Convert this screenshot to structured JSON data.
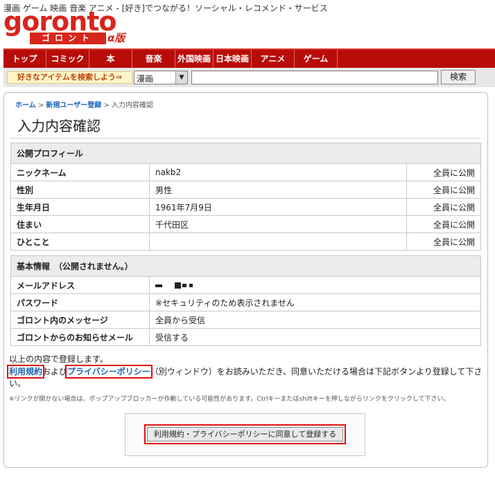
{
  "header": {
    "tagline": "漫画 ゲーム 映画 音楽 アニメ - [好き]でつながる！ソーシャル・レコメンド・サービス",
    "logo_text": "goronto",
    "logo_sub": "ゴロント",
    "logo_alpha": "α版"
  },
  "nav": {
    "items": [
      "トップ",
      "コミック",
      "本",
      "音楽",
      "外国映画",
      "日本映画",
      "アニメ",
      "ゲーム"
    ]
  },
  "search": {
    "label": "好きなアイテムを検索しよう⇒",
    "category": "漫画",
    "query": "",
    "button": "検索"
  },
  "breadcrumb": {
    "home": "ホーム",
    "register": "新規ユーザー登録",
    "current": "入力内容確認"
  },
  "page_title": "入力内容確認",
  "profile": {
    "header": "公開プロフィール",
    "rows": [
      {
        "label": "ニックネーム",
        "value": "nakb2",
        "visibility": "全員に公開"
      },
      {
        "label": "性別",
        "value": "男性",
        "visibility": "全員に公開"
      },
      {
        "label": "生年月日",
        "value": "1961年7月9日",
        "visibility": "全員に公開"
      },
      {
        "label": "住まい",
        "value": "千代田区",
        "visibility": "全員に公開"
      },
      {
        "label": "ひとこと",
        "value": "",
        "visibility": "全員に公開"
      }
    ]
  },
  "basic": {
    "header": "基本情報　（公開されません。）",
    "rows": [
      {
        "label": "メールアドレス",
        "value": ""
      },
      {
        "label": "パスワード",
        "value": "※セキュリティのため表示されません"
      },
      {
        "label": "ゴロント内のメッセージ",
        "value": "全員から受信"
      },
      {
        "label": "ゴロントからのお知らせメール",
        "value": "受信する"
      }
    ]
  },
  "confirm": {
    "notice": "以上の内容で登録します。",
    "terms_link": "利用規約",
    "and": "および",
    "privacy_link": "プライバシーポリシー",
    "rest": "（別ウィンドウ）をお読みいただき、同意いただける場合は下記ボタンより登録して下さい。",
    "note": "※リンクが開かない場合は、ポップアップブロッカーが作動している可能性があります。Ctrlキーまたはshiftキーを押しながらリンクをクリックして下さい。",
    "submit": "利用規約・プライバシーポリシーに同意して登録する"
  },
  "colors": {
    "brand_red": "#d7261b",
    "nav_bg": "#b80c09",
    "link": "#1b63b5",
    "highlight": "#e01010"
  }
}
